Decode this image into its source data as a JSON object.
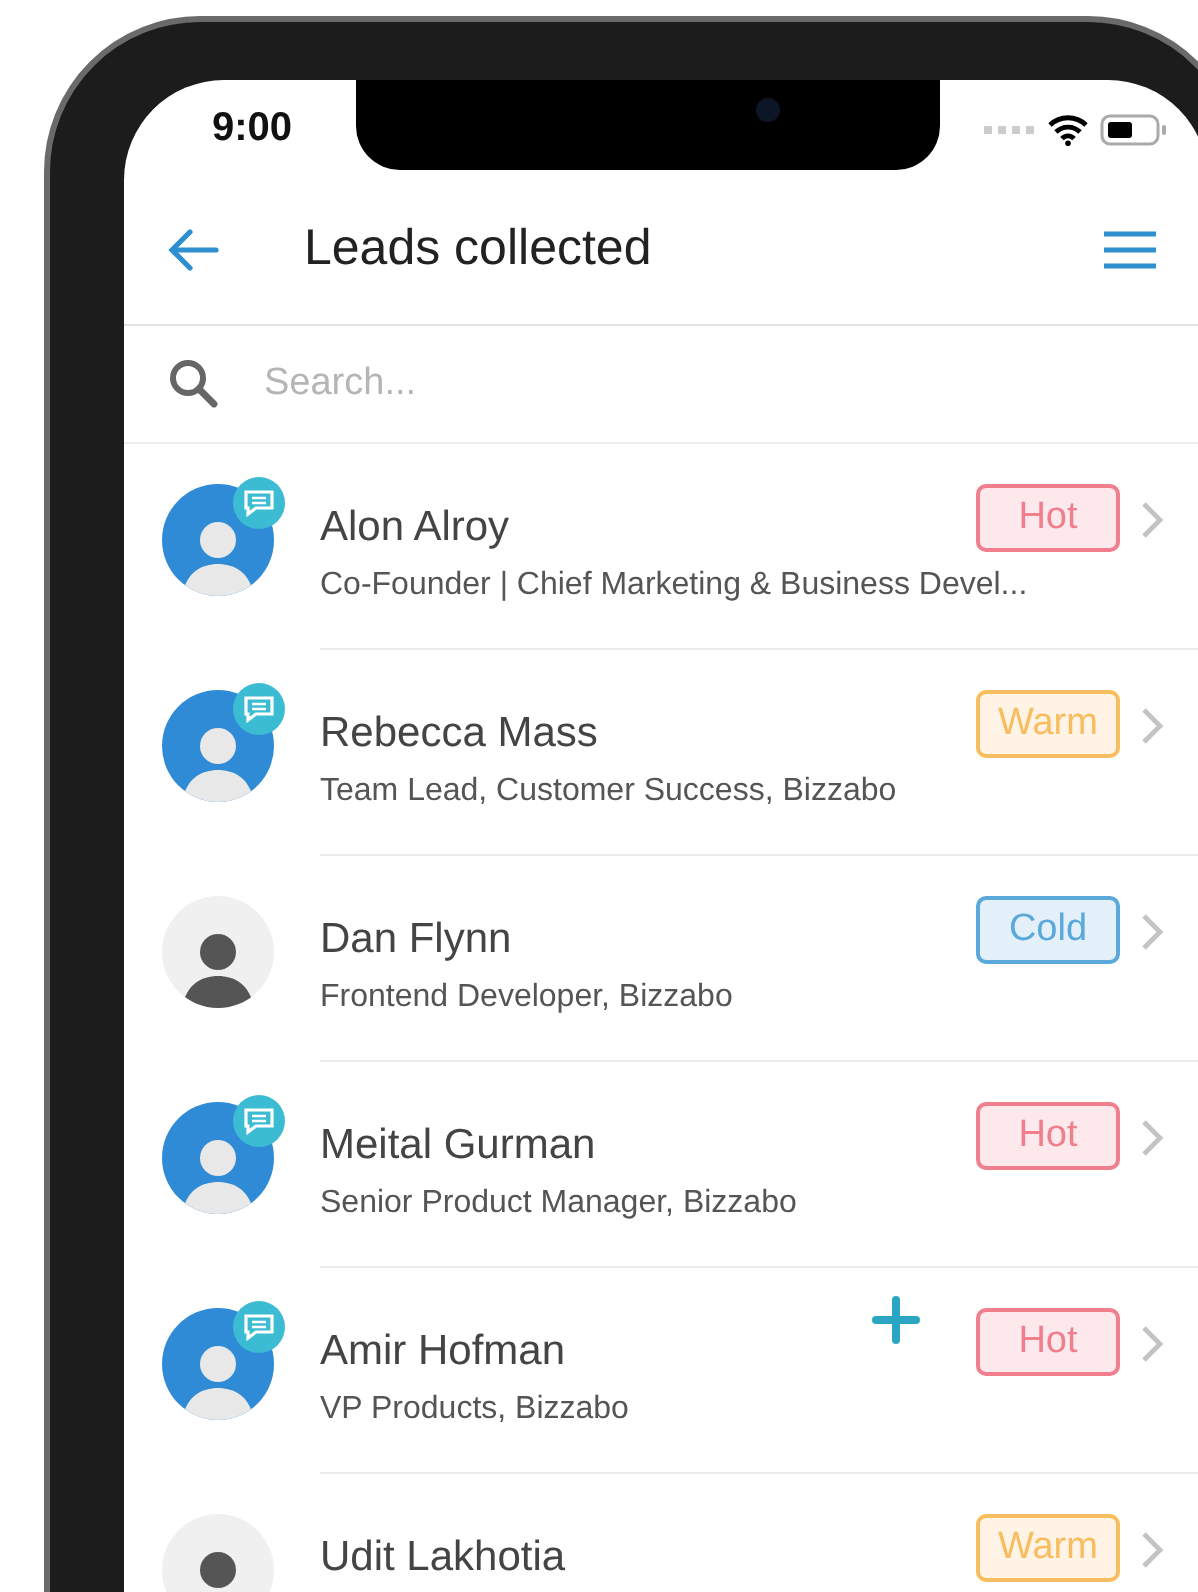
{
  "status_bar": {
    "time": "9:00"
  },
  "header": {
    "title": "Leads collected"
  },
  "search": {
    "placeholder": "Search..."
  },
  "leads": [
    {
      "name": "Alon Alroy",
      "subtitle": "Co-Founder | Chief Marketing & Business Devel...",
      "tag": "Hot",
      "kind": "hot",
      "has_chat": true
    },
    {
      "name": "Rebecca Mass",
      "subtitle": "Team Lead, Customer Success, Bizzabo",
      "tag": "Warm",
      "kind": "warm",
      "has_chat": true
    },
    {
      "name": "Dan Flynn",
      "subtitle": "Frontend Developer, Bizzabo",
      "tag": "Cold",
      "kind": "cold",
      "has_chat": false
    },
    {
      "name": "Meital Gurman",
      "subtitle": "Senior Product Manager, Bizzabo",
      "tag": "Hot",
      "kind": "hot",
      "has_chat": true
    },
    {
      "name": "Amir Hofman",
      "subtitle": "VP Products, Bizzabo",
      "tag": "Hot",
      "kind": "hot",
      "has_chat": true
    },
    {
      "name": "Udit Lakhotia",
      "tag": "Warm",
      "kind": "warm",
      "has_chat": false
    }
  ]
}
